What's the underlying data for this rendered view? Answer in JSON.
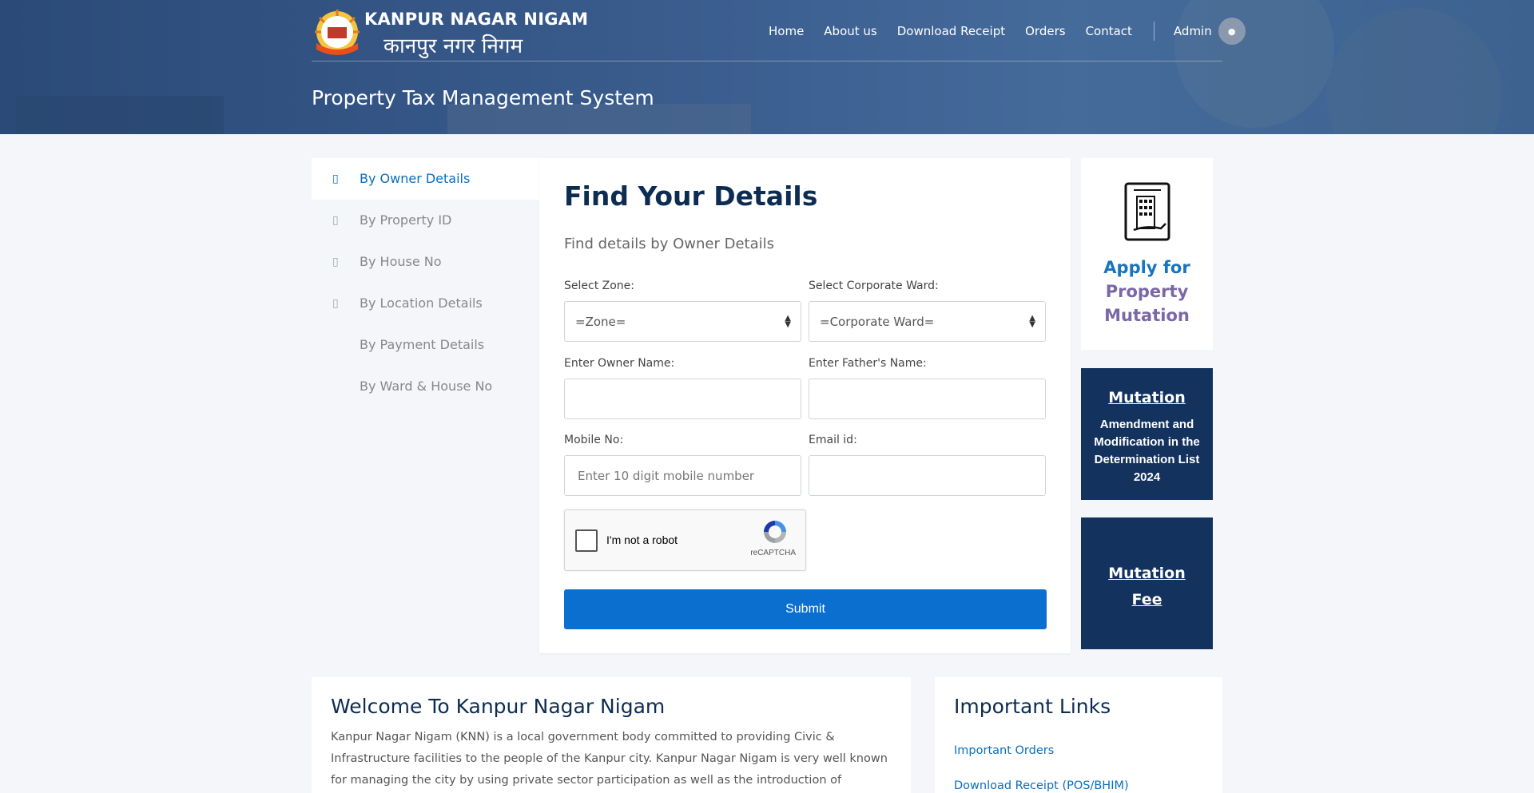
{
  "header": {
    "logo_en": "KANPUR NAGAR NIGAM",
    "logo_hi": "कानपुर नगर निगम",
    "nav": [
      "Home",
      "About us",
      "Download Receipt",
      "Orders",
      "Contact"
    ],
    "admin_label": "Admin",
    "page_title": "Property Tax Management System"
  },
  "sidebar": {
    "items": [
      {
        "label": "By Owner Details",
        "active": true
      },
      {
        "label": "By Property ID"
      },
      {
        "label": "By House No"
      },
      {
        "label": "By Location Details"
      },
      {
        "label": "By Payment Details"
      },
      {
        "label": "By Ward & House No"
      }
    ]
  },
  "form": {
    "title": "Find Your Details",
    "subtitle": "Find details by Owner Details",
    "zone_label": "Select Zone:",
    "zone_value": "=Zone=",
    "ward_label": "Select Corporate Ward:",
    "ward_value": "=Corporate Ward=",
    "owner_label": "Enter Owner Name:",
    "father_label": "Enter Father's Name:",
    "mobile_label": "Mobile No:",
    "mobile_placeholder": "Enter 10 digit mobile number",
    "email_label": "Email id:",
    "captcha_text": "I'm not a robot",
    "captcha_brand": "reCAPTCHA",
    "submit_label": "Submit"
  },
  "right": {
    "apply_line1": "Apply for",
    "apply_line2": "Property",
    "apply_line3": "Mutation",
    "mutation_title": "Mutation",
    "mutation_body": "Amendment and Modification in the Determination List 2024",
    "fee_line1": "Mutation",
    "fee_line2": "Fee"
  },
  "welcome": {
    "title": "Welcome To Kanpur Nagar Nigam",
    "body": "Kanpur Nagar Nigam (KNN) is a local government body committed to providing Civic & Infrastructure facilities to the people of the Kanpur city. Kanpur Nagar Nigam is very well known for managing the city by using private sector participation as well as the introduction of innovative"
  },
  "links": {
    "title": "Important Links",
    "items": [
      "Important Orders",
      "Download Receipt (POS/BHIM)"
    ]
  },
  "colors": {
    "primary": "#0a6fce",
    "navy": "#13325e",
    "heading": "#0d2c52"
  }
}
